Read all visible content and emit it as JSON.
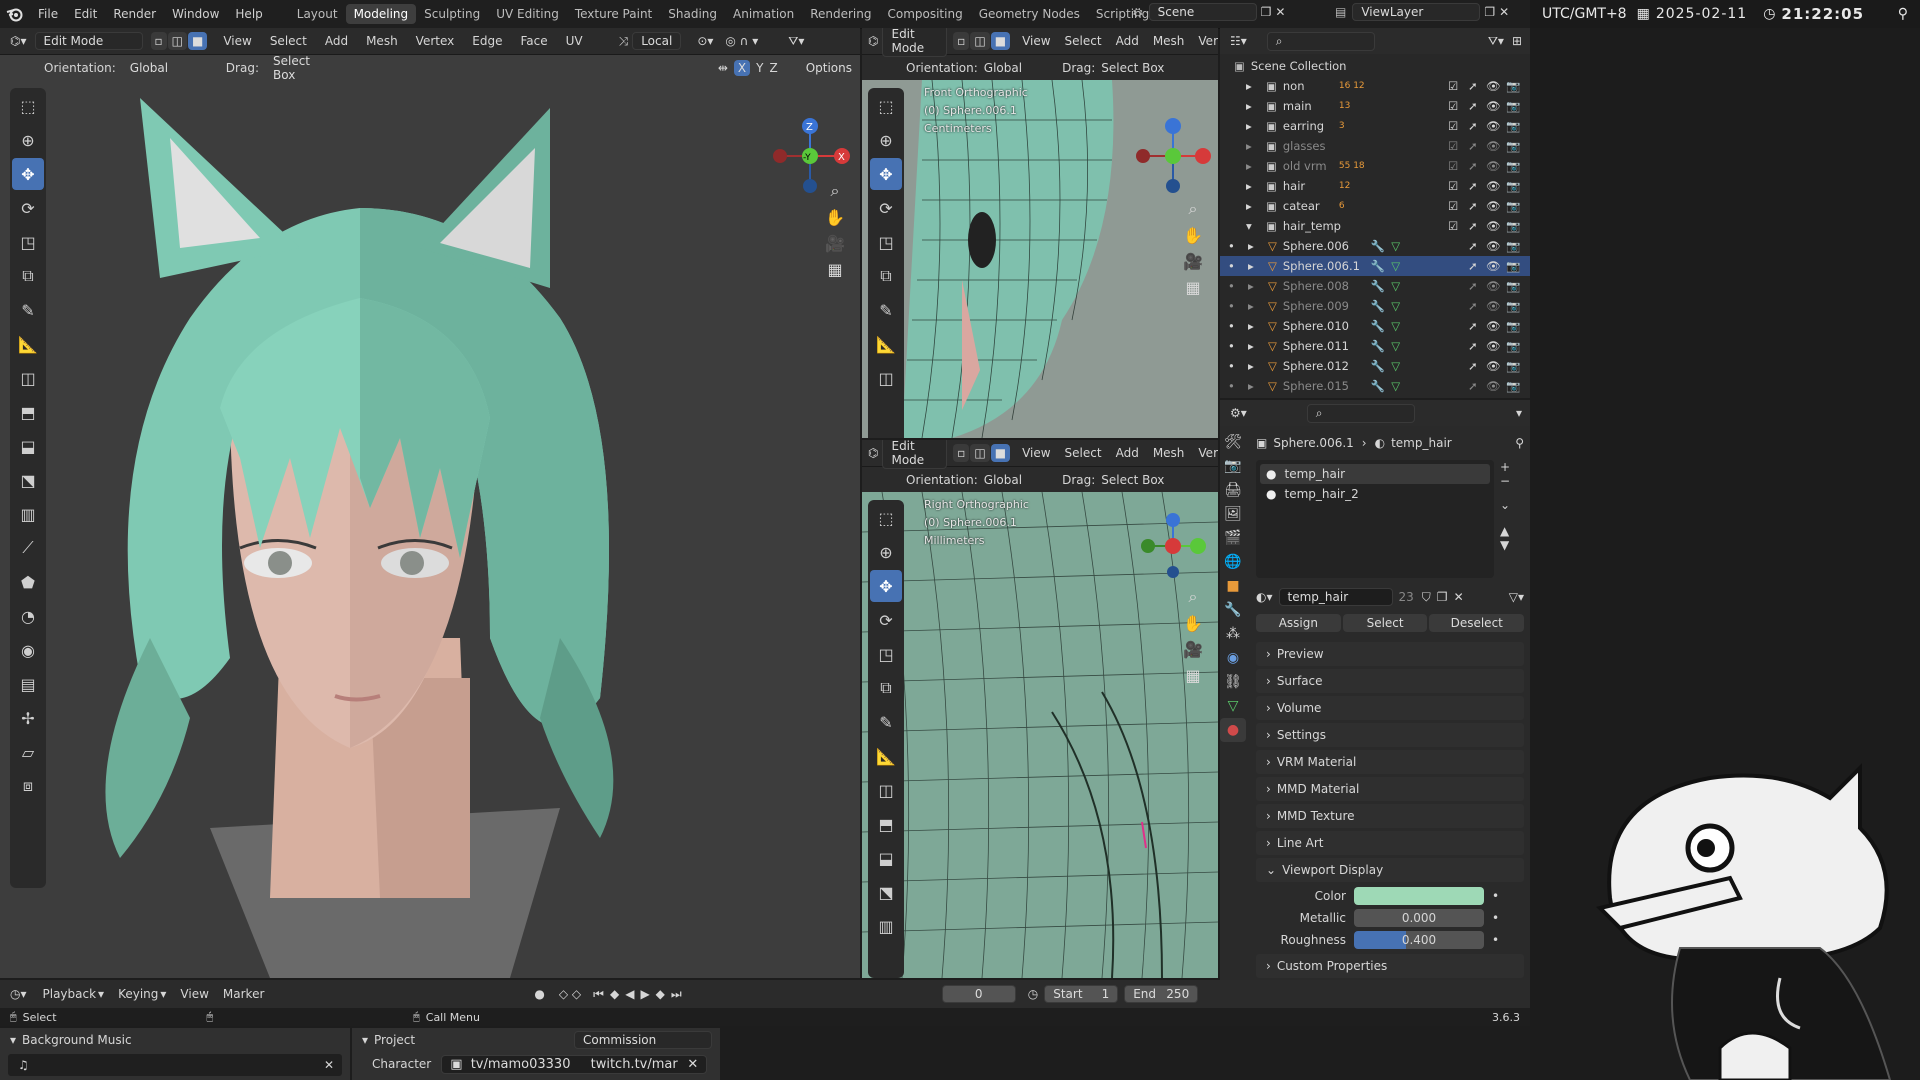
{
  "menu": [
    "File",
    "Edit",
    "Render",
    "Window",
    "Help"
  ],
  "workspaces": [
    "Layout",
    "Modeling",
    "Sculpting",
    "UV Editing",
    "Texture Paint",
    "Shading",
    "Animation",
    "Rendering",
    "Compositing",
    "Geometry Nodes",
    "Scripting"
  ],
  "active_workspace": "Modeling",
  "scene_name": "Scene",
  "view_layer": "ViewLayer",
  "clock": {
    "tz": "UTC/GMT+8",
    "date": "2025-02-11",
    "time": "21:22:05"
  },
  "main_vp": {
    "mode": "Edit Mode",
    "menus": [
      "View",
      "Select",
      "Add",
      "Mesh",
      "Vertex",
      "Edge",
      "Face",
      "UV"
    ],
    "pivot": "Local",
    "orientation_label": "Orientation:",
    "orientation": "Global",
    "drag_label": "Drag:",
    "drag": "Select Box",
    "options": "Options",
    "axes": [
      "X",
      "Y",
      "Z"
    ]
  },
  "front_vp": {
    "mode": "Edit Mode",
    "menus": [
      "View",
      "Select",
      "Add",
      "Mesh",
      "Ver"
    ],
    "orientation_label": "Orientation:",
    "orientation": "Global",
    "drag_label": "Drag:",
    "drag": "Select Box",
    "title": "Front Orthographic",
    "object": "(0) Sphere.006.1",
    "units": "Centimeters"
  },
  "right_vp": {
    "mode": "Edit Mode",
    "menus": [
      "View",
      "Select",
      "Add",
      "Mesh",
      "Ver"
    ],
    "orientation_label": "Orientation:",
    "orientation": "Global",
    "drag_label": "Drag:",
    "drag": "Select Box",
    "title": "Right Orthographic",
    "object": "(0) Sphere.006.1",
    "units": "Millimeters"
  },
  "gizmo": {
    "x": "X",
    "y": "Y",
    "z": "Z",
    "ny": "-Y"
  },
  "outliner": {
    "root": "Scene Collection",
    "collections": [
      {
        "name": "non",
        "badge": "16  12"
      },
      {
        "name": "main",
        "badge": "13"
      },
      {
        "name": "earring",
        "badge": "3"
      },
      {
        "name": "glasses",
        "badge": ""
      },
      {
        "name": "old vrm",
        "badge": "55  18"
      },
      {
        "name": "hair",
        "badge": "12"
      },
      {
        "name": "catear",
        "badge": "6"
      },
      {
        "name": "hair_temp",
        "badge": ""
      }
    ],
    "children": [
      "Sphere.006",
      "Sphere.006.1",
      "Sphere.008",
      "Sphere.009",
      "Sphere.010",
      "Sphere.011",
      "Sphere.012",
      "Sphere.015"
    ]
  },
  "props": {
    "breadcrumb_obj": "Sphere.006.1",
    "breadcrumb_mat": "temp_hair",
    "slots": [
      "temp_hair",
      "temp_hair_2"
    ],
    "material_name": "temp_hair",
    "users": "23",
    "buttons": {
      "assign": "Assign",
      "select": "Select",
      "deselect": "Deselect"
    },
    "panels": [
      "Preview",
      "Surface",
      "Volume",
      "Settings",
      "VRM Material",
      "MMD Material",
      "MMD Texture",
      "Line Art"
    ],
    "viewport_display": "Viewport Display",
    "color_label": "Color",
    "metallic_label": "Metallic",
    "metallic": "0.000",
    "roughness_label": "Roughness",
    "roughness": "0.400",
    "custom": "Custom Properties",
    "viewport_color": "#9ed9b6"
  },
  "timeline": {
    "menus": [
      "Playback",
      "Keying",
      "View",
      "Marker"
    ],
    "frame": "0",
    "start_label": "Start",
    "start": "1",
    "end_label": "End",
    "end": "250"
  },
  "status": {
    "select": "Select",
    "call_menu": "Call Menu",
    "version": "3.6.3"
  },
  "overlay": {
    "bgm_title": "Background Music",
    "project_title": "Project",
    "project_value": "Commission",
    "character_label": "Character",
    "character_value": "tv/mamo03330",
    "twitch": "twitch.tv/mar"
  }
}
